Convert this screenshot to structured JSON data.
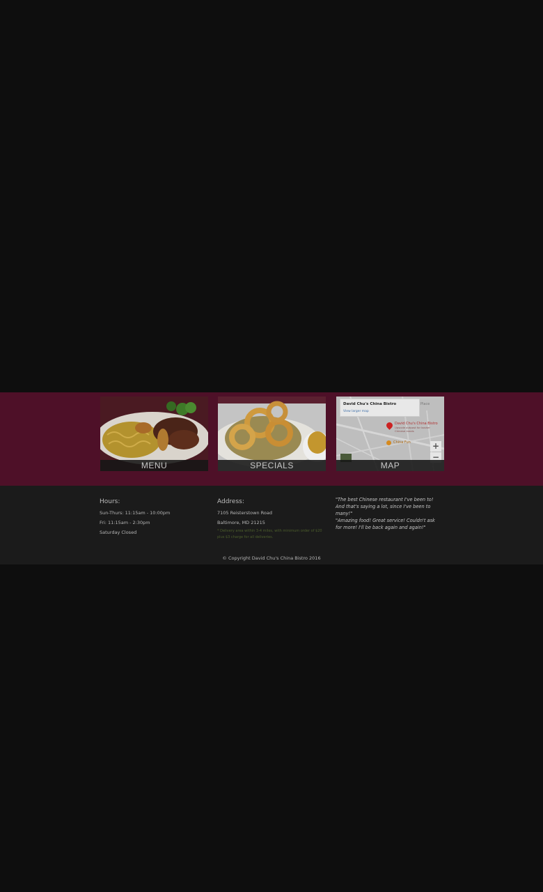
{
  "tiles": [
    {
      "label": "MENU"
    },
    {
      "label": "SPECIALS"
    },
    {
      "label": "MAP"
    }
  ],
  "map": {
    "card_title": "David Chu's China Bistro",
    "card_link": "View larger map",
    "places_label": "Place",
    "pin1_label": "David Chu's China Bistro",
    "pin1_sub": "Upscale outpost for kosher Chinese meals",
    "pin2_label": "China Fun",
    "zoom_in": "+",
    "zoom_out": "−"
  },
  "hours": {
    "heading": "Hours:",
    "lines": [
      "Sun-Thurs: 11:15am - 10:00pm",
      "Fri: 11:15am - 2:30pm",
      "Saturday Closed"
    ]
  },
  "address": {
    "heading": "Address:",
    "line1": "7105 Reisterstown Road",
    "line2": "Baltimore, MD 21215",
    "note": "* Delivery area within 3-4 miles, with minimum order of $20 plus $3 charge for all deliveries."
  },
  "testimonials": [
    "\"The best Chinese restaurant I've been to! And that's saying a lot, since I've been to many!\"",
    "\"Amazing food! Great service! Couldn't ask for more! I'll be back again and again!\""
  ],
  "footer": {
    "copyright": "© Copyright David Chu's China Bistro 2016"
  },
  "colors": {
    "page_background": "#0e0e0e",
    "tiles_band": "#4e1028",
    "info_band": "#1b1b1b"
  }
}
